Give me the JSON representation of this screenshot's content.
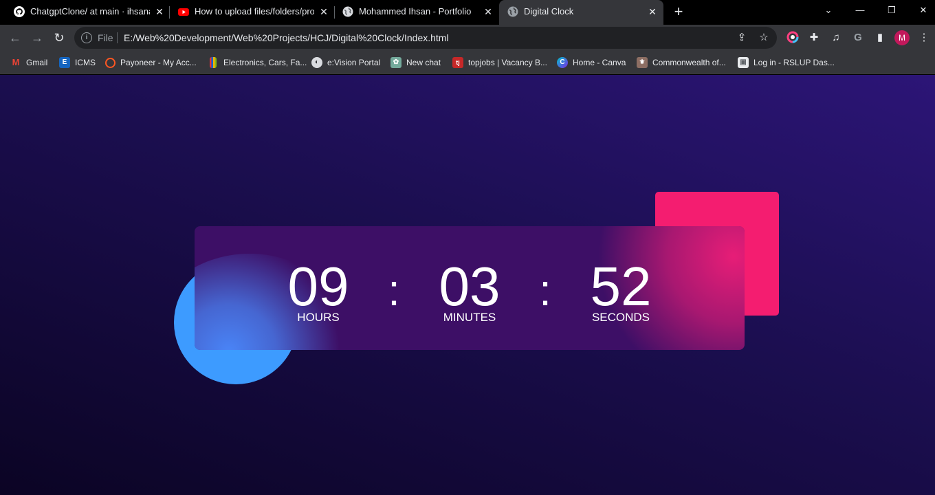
{
  "browser": {
    "tabs": [
      {
        "title": "ChatgptClone/ at main · ihsanakmal",
        "icon": "github-icon",
        "active": false
      },
      {
        "title": "How to upload files/folders/project",
        "icon": "youtube-icon",
        "active": false
      },
      {
        "title": "Mohammed Ihsan - Portfolio",
        "icon": "globe-icon",
        "active": false
      },
      {
        "title": "Digital Clock",
        "icon": "globe-icon",
        "active": true
      }
    ],
    "omnibox": {
      "scheme": "File",
      "url": "E:/Web%20Development/Web%20Projects/HCJ/Digital%20Clock/Index.html"
    },
    "profile_initial": "M",
    "bookmarks": [
      {
        "label": "Gmail",
        "icon": "gmail-icon",
        "color": "#ea4335",
        "glyph": "M"
      },
      {
        "label": "ICMS",
        "icon": "icms-icon",
        "color": "#1565c0",
        "glyph": "E"
      },
      {
        "label": "Payoneer - My Acc...",
        "icon": "payoneer-icon",
        "color": "#ff5722",
        "glyph": "○"
      },
      {
        "label": "Electronics, Cars, Fa...",
        "icon": "ebay-icon",
        "color": "#86b817",
        "glyph": "▮"
      },
      {
        "label": "e:Vision Portal",
        "icon": "globe-icon",
        "color": "#5f6368",
        "glyph": "◉"
      },
      {
        "label": "New chat",
        "icon": "chatgpt-icon",
        "color": "#74aa9c",
        "glyph": "✿"
      },
      {
        "label": "topjobs | Vacancy B...",
        "icon": "topjobs-icon",
        "color": "#c62828",
        "glyph": "tj"
      },
      {
        "label": "Home - Canva",
        "icon": "canva-icon",
        "color": "#7d2ae8",
        "glyph": "C"
      },
      {
        "label": "Commonwealth of...",
        "icon": "commonwealth-icon",
        "color": "#8d6e63",
        "glyph": "⚜"
      },
      {
        "label": "Log in - RSLUP Das...",
        "icon": "page-icon",
        "color": "#e8eaed",
        "glyph": "▣"
      }
    ]
  },
  "clock": {
    "hours": "09",
    "minutes": "03",
    "seconds": "52",
    "hours_label": "HOURS",
    "minutes_label": "MINUTES",
    "seconds_label": "SECONDS",
    "separator": ":"
  },
  "colors": {
    "background_top": "#2c1577",
    "background_bottom": "#0b0424",
    "circle": "#3d9bff",
    "square": "#f41d70",
    "glass": "#3d0f66"
  }
}
